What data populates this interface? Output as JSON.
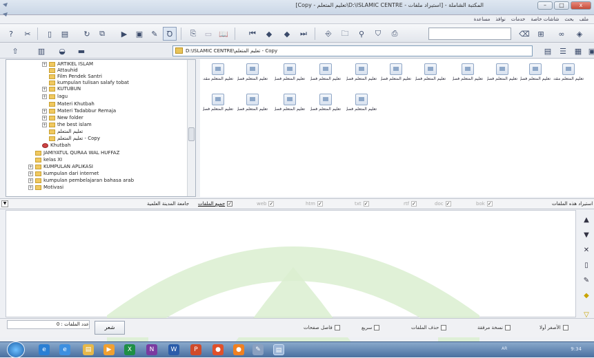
{
  "window": {
    "title": "المكتبة الشاملة - [استيراد ملفات - D:\\ISLAMIC CENTRE\\تعليم المتعلم - Copy]",
    "controls": {
      "minimize": "–",
      "maximize": "□",
      "close": "x"
    }
  },
  "menu": {
    "items": [
      "ملف",
      "بحث",
      "شاشات خاصة",
      "خدمات",
      "نوافذ",
      "مساعدة"
    ]
  },
  "address": {
    "path": "D:\\ISLAMIC CENTRE\\تعليم المتعلم - Copy"
  },
  "tree": {
    "items": [
      {
        "label": "ARTIKEL ISLAM",
        "expandable": true
      },
      {
        "label": "Attauhid",
        "expandable": false
      },
      {
        "label": "Film Pendek Santri",
        "expandable": false
      },
      {
        "label": "kumpulan tulisan salafy tobat",
        "expandable": false
      },
      {
        "label": "KUTUBUN",
        "expandable": true
      },
      {
        "label": "lagu",
        "expandable": true
      },
      {
        "label": "Materi Khutbah",
        "expandable": false
      },
      {
        "label": "Materi Tadabbur Remaja",
        "expandable": true
      },
      {
        "label": "New folder",
        "expandable": true
      },
      {
        "label": "the best islam",
        "expandable": true
      },
      {
        "label": "تعليم المتعلم",
        "expandable": false
      },
      {
        "label": "تعليم المتعلم - Copy",
        "expandable": false
      },
      {
        "label": "Khutbah",
        "expandable": false
      },
      {
        "label": "JAMIYATUL QURAA WAL HUFFAZ",
        "expandable": false
      },
      {
        "label": "kelas XI",
        "expandable": false
      },
      {
        "label": "KUMPULAN APLIKASI",
        "expandable": true
      },
      {
        "label": "kumpulan dari internet",
        "expandable": true
      },
      {
        "label": "kumpulan pembelajaran bahasa arab",
        "expandable": true
      },
      {
        "label": "Motivasi",
        "expandable": true
      }
    ]
  },
  "files": {
    "row1": [
      "تعليم المتعلم مقدمات",
      "تعليم المتعلم فصل 4 في",
      "تعليم المتعلم فصل 4 في",
      "تعليم المتعلم فصل 3 في",
      "تعليم المتعلم فصل 3 في",
      "تعليم المتعلم فصل 2 في",
      "تعليم المتعلم فصل 2 في",
      "تعليم المتعلم فصل 1 في م",
      "تعليم المتعلم فصل 1 في م",
      "تعليم المتعلم فصل 1 في م",
      "تعليم المتعلم مقدمات"
    ],
    "row2": [
      "تعليم المتعلم فصل 4 في",
      "تعليم المتعلم فصل 4 في",
      "تعليم المتعلم فصل 5 في ا",
      "تعليم المتعلم فصل 5 في ا",
      "تعليم المتعلم فصل 5 في ا"
    ]
  },
  "filters": {
    "import_label": "استيراد هذه الملفات",
    "all_files": "جميع الملفات",
    "types": [
      "bok",
      "doc",
      "rtf",
      "txt",
      "htm",
      "web"
    ],
    "library": "جامعة المدينة العلمية"
  },
  "options": {
    "smallest_first": "الأصغر أولا",
    "copy": "نسخة مرفقة",
    "delete_files": "حذف الملفات",
    "fast": "سريع",
    "page_separator": "فاصل صفحات",
    "poetry_button": "شعر",
    "file_count_label": "عدد الملفات :",
    "file_count": "0"
  },
  "taskbar": {
    "lang": "AR",
    "time": "9:34"
  }
}
